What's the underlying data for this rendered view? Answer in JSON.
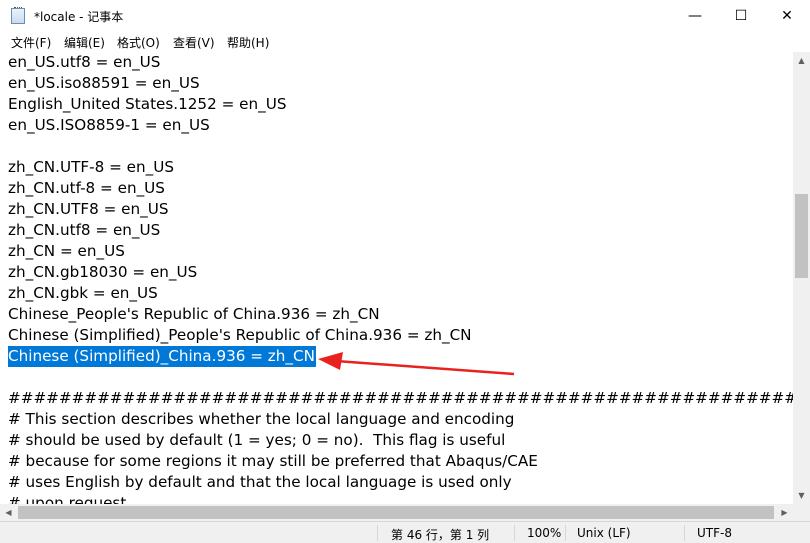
{
  "window": {
    "title": "*locale - 记事本",
    "minimize": "—",
    "maximize": "☐",
    "close": "✕"
  },
  "menu": [
    "文件(F)",
    "编辑(E)",
    "格式(O)",
    "查看(V)",
    "帮助(H)"
  ],
  "lines": [
    "en_US.utf8 = en_US",
    "en_US.iso88591 = en_US",
    "English_United States.1252 = en_US",
    "en_US.ISO8859-1 = en_US",
    "",
    "zh_CN.UTF-8 = en_US",
    "zh_CN.utf-8 = en_US",
    "zh_CN.UTF8 = en_US",
    "zh_CN.utf8 = en_US",
    "zh_CN = en_US",
    "zh_CN.gb18030 = en_US",
    "zh_CN.gbk = en_US",
    "Chinese_People's Republic of China.936 = zh_CN",
    "Chinese (Simplified)_People's Republic of China.936 = zh_CN",
    "Chinese (Simplified)_China.936 = zh_CN",
    "",
    "##############################################################",
    "# This section describes whether the local language and encoding",
    "# should be used by default (1 = yes; 0 = no).  This flag is useful",
    "# because for some regions it may still be preferred that Abaqus/CAE",
    "# uses English by default and that the local language is used only",
    "# upon request."
  ],
  "selected_line": 14,
  "status": {
    "position": "第 46 行，第 1 列",
    "zoom": "100%",
    "line_ending": "Unix (LF)",
    "encoding": "UTF-8"
  },
  "colors": {
    "selection": "#0078d7",
    "annotation_arrow": "#e8231f"
  }
}
